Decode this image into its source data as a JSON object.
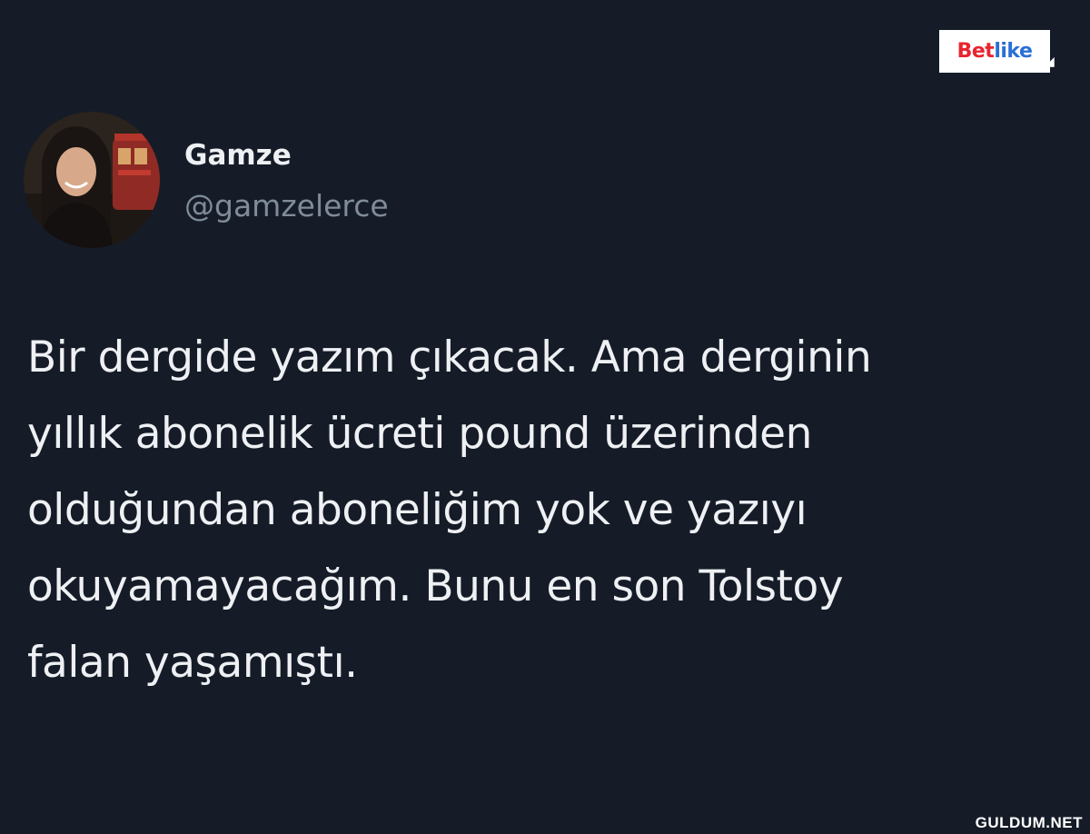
{
  "logo": {
    "part1": "Bet",
    "part2": "like"
  },
  "author": {
    "display_name": "Gamze",
    "handle": "@gamzelerce"
  },
  "tweet": {
    "text": "Bir dergide yazım çıkacak. Ama derginin\nyıllık abonelik ücreti pound üzerinden\nolduğundan aboneliğim yok ve yazıyı\nokuyamayacağım. Bunu en son Tolstoy\nfalan yaşamıştı."
  },
  "watermark": "GULDUM.NET",
  "colors": {
    "background": "#151c28",
    "text_primary": "#eef0f3",
    "text_secondary": "#7f8b99",
    "logo_red": "#e8242f",
    "logo_blue": "#2a6fd6"
  }
}
